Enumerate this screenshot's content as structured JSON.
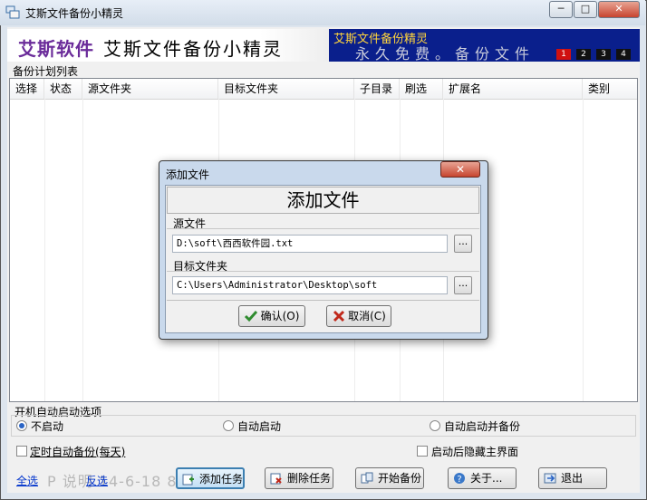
{
  "window": {
    "title": "艾斯文件备份小精灵",
    "controls": {
      "minimize": "─",
      "maximize": "□",
      "close": "✕"
    }
  },
  "banner": {
    "logo": "艾斯软件",
    "title": "艾斯文件备份小精灵",
    "marquee_line1": "艾斯文件备份精灵",
    "marquee_line2": "永久免费。备份文件",
    "marquee_pages": [
      "1",
      "2",
      "3",
      "4"
    ]
  },
  "task_list": {
    "group_label": "备份计划列表",
    "columns": [
      "选择",
      "状态",
      "源文件夹",
      "目标文件夹",
      "子目录",
      "刷选",
      "扩展名",
      "类别"
    ]
  },
  "startup_options": {
    "label": "开机自动启动选项",
    "radios": [
      {
        "label": "不启动",
        "selected": true
      },
      {
        "label": "自动启动",
        "selected": false
      },
      {
        "label": "自动启动并备份",
        "selected": false
      }
    ],
    "timed_backup": "定时自动备份(每天)",
    "hide_after_start": "启动后隐藏主界面"
  },
  "bottom": {
    "select_all": "全选",
    "invert": "反选",
    "ghost_text": "P  说明  14-6-18 8:23:39",
    "buttons": {
      "add_task": "添加任务",
      "delete_task": "删除任务",
      "start_backup": "开始备份",
      "about": "关于...",
      "exit": "退出"
    }
  },
  "dialog": {
    "window_title": "添加文件",
    "heading": "添加文件",
    "source_label": "源文件",
    "source_value": "D:\\soft\\西西软件园.txt",
    "target_label": "目标文件夹",
    "target_value": "C:\\Users\\Administrator\\Desktop\\soft",
    "browse_label": "...",
    "ok_label": "确认(O)",
    "cancel_label": "取消(C)",
    "close": "✕"
  },
  "colors": {
    "marquee_bg": "#0a1f8c",
    "logo": "#6b2c9a",
    "ok_icon": "#2e8b2e",
    "cancel_icon": "#c0281a",
    "link": "#0033cc"
  }
}
